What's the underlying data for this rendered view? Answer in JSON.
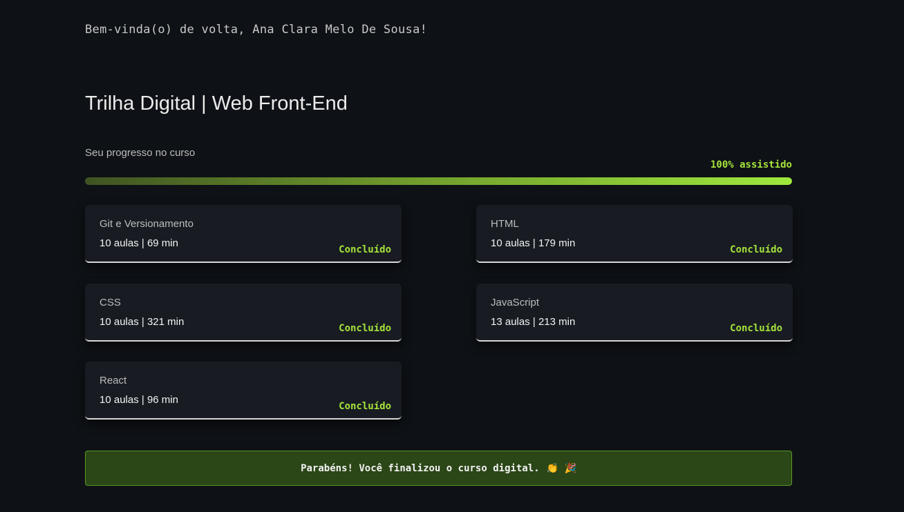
{
  "header": {
    "greeting": "Bem-vinda(o) de volta, Ana Clara Melo De Sousa!"
  },
  "course": {
    "title": "Trilha Digital | Web Front-End"
  },
  "progress": {
    "label": "Seu progresso no curso",
    "percent_text": "100% assistido",
    "percent": 100
  },
  "modules": [
    {
      "name": "Git e Versionamento",
      "meta": "10 aulas | 69 min",
      "status": "Concluído"
    },
    {
      "name": "HTML",
      "meta": "10 aulas | 179 min",
      "status": "Concluído"
    },
    {
      "name": "CSS",
      "meta": "10 aulas | 321 min",
      "status": "Concluído"
    },
    {
      "name": "JavaScript",
      "meta": "13 aulas | 213 min",
      "status": "Concluído"
    },
    {
      "name": "React",
      "meta": "10 aulas | 96 min",
      "status": "Concluído"
    }
  ],
  "banner": {
    "message": "Parabéns! Você finalizou o curso digital.",
    "emoji": "👏 🎉"
  },
  "colors": {
    "background": "#0e1115",
    "accent": "#a6e43c",
    "card": "#181c22",
    "banner_bg": "#2b4617",
    "banner_border": "#5c9a28"
  }
}
